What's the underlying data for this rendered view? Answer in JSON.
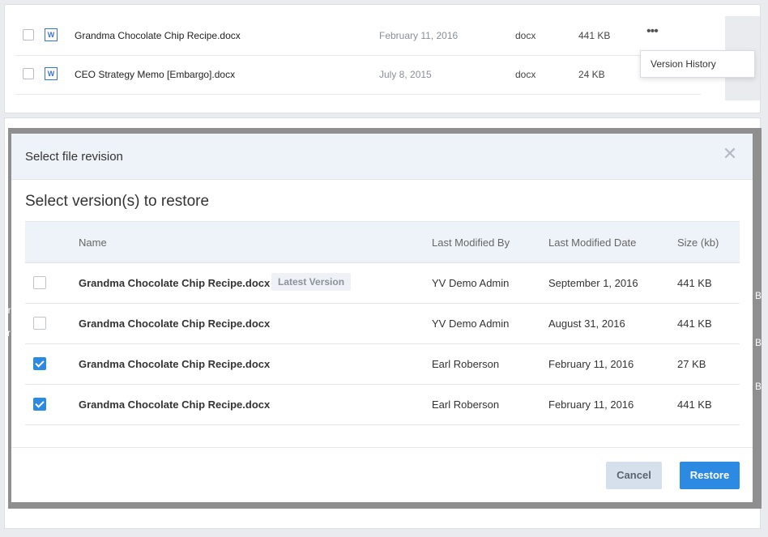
{
  "files": [
    {
      "name": "Grandma Chocolate Chip Recipe.docx",
      "date": "February 11, 2016",
      "type": "docx",
      "size": "441 KB",
      "icon": "W",
      "more": "•••"
    },
    {
      "name": "CEO Strategy Memo [Embargo].docx",
      "date": "July 8, 2015",
      "type": "docx",
      "size": "24 KB",
      "icon": "W"
    }
  ],
  "context_menu": {
    "item": "Version History"
  },
  "backdrop_fragments": [
    "ir",
    "B",
    "r",
    "B",
    "B"
  ],
  "modal": {
    "title": "Select file revision",
    "close_symbol": "✕",
    "subtitle": "Select version(s) to restore",
    "columns": {
      "name": "Name",
      "modified_by": "Last Modified By",
      "modified_date": "Last Modified Date",
      "size": "Size (kb)"
    },
    "versions": [
      {
        "name": "Grandma Chocolate Chip Recipe.docx",
        "badge": "Latest Version",
        "modified_by": "YV Demo Admin",
        "date": "September 1, 2016",
        "size": "441 KB",
        "checked": false
      },
      {
        "name": "Grandma Chocolate Chip Recipe.docx",
        "modified_by": "YV Demo Admin",
        "date": "August 31, 2016",
        "size": "441 KB",
        "checked": false
      },
      {
        "name": "Grandma Chocolate Chip Recipe.docx",
        "modified_by": "Earl Roberson",
        "date": "February 11, 2016",
        "size": "27 KB",
        "checked": true
      },
      {
        "name": "Grandma Chocolate Chip Recipe.docx",
        "modified_by": "Earl Roberson",
        "date": "February 11, 2016",
        "size": "441 KB",
        "checked": true
      }
    ],
    "cancel_label": "Cancel",
    "restore_label": "Restore"
  },
  "colors": {
    "accent": "#2d8ae2",
    "header_bg": "#eef3f9",
    "backdrop": "#8f8f8f"
  }
}
